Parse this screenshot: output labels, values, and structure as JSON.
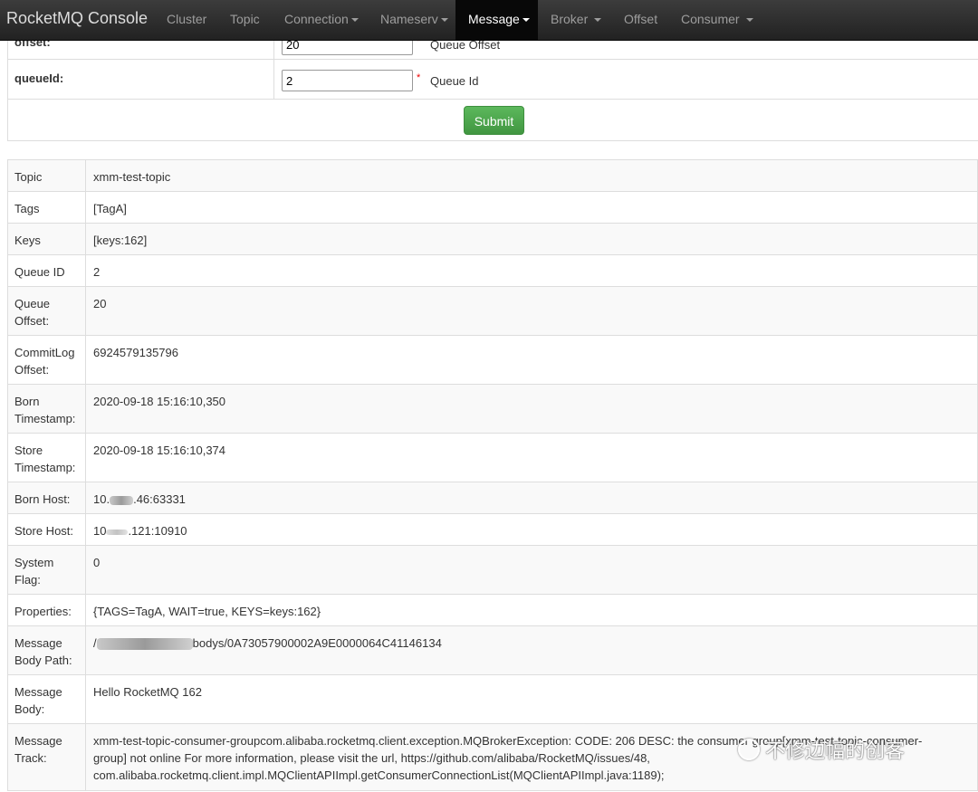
{
  "navbar": {
    "brand": "RocketMQ Console",
    "items": [
      {
        "label": "Cluster",
        "dropdown": false,
        "active": false
      },
      {
        "label": "Topic",
        "dropdown": false,
        "active": false
      },
      {
        "label": "Connection",
        "dropdown": true,
        "active": false
      },
      {
        "label": "Nameserv",
        "dropdown": true,
        "active": false
      },
      {
        "label": "Message",
        "dropdown": true,
        "active": true
      },
      {
        "label": "Broker",
        "dropdown": true,
        "active": false
      },
      {
        "label": "Offset",
        "dropdown": false,
        "active": false
      },
      {
        "label": "Consumer",
        "dropdown": true,
        "active": false
      }
    ]
  },
  "form": {
    "offset_label": "offset:",
    "offset_value": "20",
    "offset_hint": "Queue Offset",
    "queueid_label": "queueId:",
    "queueid_value": "2",
    "queueid_hint": "Queue Id",
    "required_mark": "*",
    "submit_label": "Submit"
  },
  "details": [
    {
      "key": "Topic",
      "value": "xmm-test-topic"
    },
    {
      "key": "Tags",
      "value": "[TagA]"
    },
    {
      "key": "Keys",
      "value": "[keys:162]"
    },
    {
      "key": "Queue ID",
      "value": "2"
    },
    {
      "key": "Queue Offset:",
      "value": "20"
    },
    {
      "key": "CommitLog Offset:",
      "value": "6924579135796"
    },
    {
      "key": "Born Timestamp:",
      "value": "2020-09-18 15:16:10,350"
    },
    {
      "key": "Store Timestamp:",
      "value": "2020-09-18 15:16:10,374"
    },
    {
      "key": "Born Host:",
      "value_prefix": "10.",
      "value_suffix": ".46:63331"
    },
    {
      "key": "Store Host:",
      "value_prefix": "10",
      "value_suffix": ".121:10910"
    },
    {
      "key": "System Flag:",
      "value": "0"
    },
    {
      "key": "Properties:",
      "value": "{TAGS=TagA, WAIT=true, KEYS=keys:162}"
    },
    {
      "key": "Message Body Path:",
      "value_prefix": "/",
      "value_suffix": "bodys/0A73057900002A9E0000064C41146134"
    },
    {
      "key": "Message Body:",
      "value": "Hello RocketMQ 162"
    },
    {
      "key": "Message Track:",
      "value": "xmm-test-topic-consumer-groupcom.alibaba.rocketmq.client.exception.MQBrokerException: CODE: 206 DESC: the consumer group[xmm-test-topic-consumer-group] not online For more information, please visit the url, https://github.com/alibaba/RocketMQ/issues/48, com.alibaba.rocketmq.client.impl.MQClientAPIImpl.getConsumerConnectionList(MQClientAPIImpl.java:1189);"
    }
  ],
  "watermark": "不修边幅的创客"
}
